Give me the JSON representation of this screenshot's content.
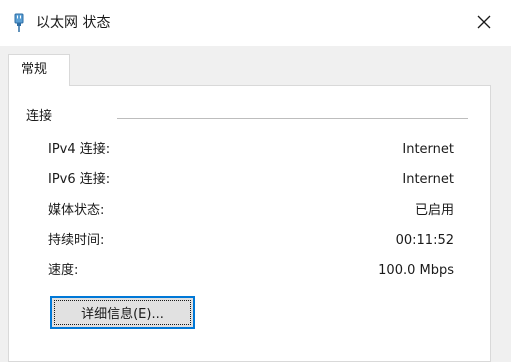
{
  "window": {
    "title": "以太网 状态",
    "title_icon": "ethernet-plug-icon",
    "close_icon": "close-icon"
  },
  "tabs": [
    {
      "label": "常规",
      "selected": true
    }
  ],
  "connection": {
    "group_title": "连接",
    "rows": [
      {
        "label": "IPv4 连接:",
        "value": "Internet"
      },
      {
        "label": "IPv6 连接:",
        "value": "Internet"
      },
      {
        "label": "媒体状态:",
        "value": "已启用"
      },
      {
        "label": "持续时间:",
        "value": "00:11:52"
      },
      {
        "label": "速度:",
        "value": "100.0 Mbps"
      }
    ]
  },
  "details_button": {
    "label": "详细信息(E)..."
  },
  "colors": {
    "accent": "#0078d7",
    "panel_border": "#d9d9d9",
    "background": "#f0f0f0"
  }
}
